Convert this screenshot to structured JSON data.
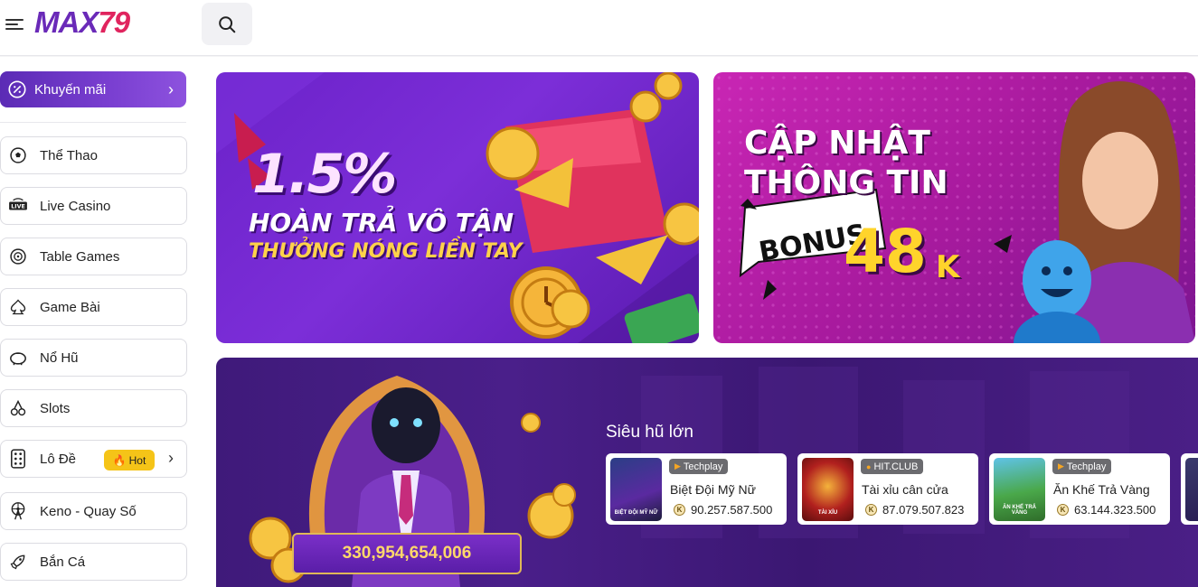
{
  "header": {
    "logo_text": "MAX",
    "logo_number": "79"
  },
  "sidebar": {
    "promo_label": "Khuyến mãi",
    "items": [
      {
        "label": "Thể Thao",
        "icon": "soccer-ball-icon"
      },
      {
        "label": "Live Casino",
        "icon": "live-icon"
      },
      {
        "label": "Table Games",
        "icon": "roulette-icon"
      },
      {
        "label": "Game Bài",
        "icon": "spade-icon"
      },
      {
        "label": "Nổ Hũ",
        "icon": "piggy-bank-icon"
      },
      {
        "label": "Slots",
        "icon": "cherry-icon"
      },
      {
        "label": "Lô Đề",
        "icon": "dice-icon",
        "badge": "Hot"
      },
      {
        "label": "Keno - Quay Số",
        "icon": "ferris-wheel-icon"
      },
      {
        "label": "Bắn Cá",
        "icon": "rocket-icon"
      }
    ]
  },
  "banners": {
    "left": {
      "percent": "1.5%",
      "line1": "HOÀN TRẢ VÔ TẬN",
      "line2": "THƯỞNG NÓNG LIỀN TAY"
    },
    "right": {
      "line1": "CẬP NHẬT",
      "line2": "THÔNG TIN",
      "bonus_word": "BONUS",
      "bonus_amount": "48",
      "bonus_unit": "K"
    }
  },
  "jackpot": {
    "pool_value": "330,954,654,006",
    "title": "Siêu hũ lớn",
    "games": [
      {
        "provider": "Techplay",
        "name": "Biệt Đội Mỹ Nữ",
        "value": "90.257.587.500",
        "thumb_text": "BIỆT ĐỘI MỸ NỮ"
      },
      {
        "provider": "HIT.CLUB",
        "name": "Tài xỉu cân cửa",
        "value": "87.079.507.823",
        "thumb_text": "TÀI XỈU"
      },
      {
        "provider": "Techplay",
        "name": "Ăn Khế Trả Vàng",
        "value": "63.144.323.500",
        "thumb_text": "ĂN KHẾ TRẢ VÀNG"
      }
    ]
  },
  "colors": {
    "brand_purple": "#6a2ab8",
    "brand_red": "#e0245e",
    "hot_badge": "#f5c418"
  }
}
